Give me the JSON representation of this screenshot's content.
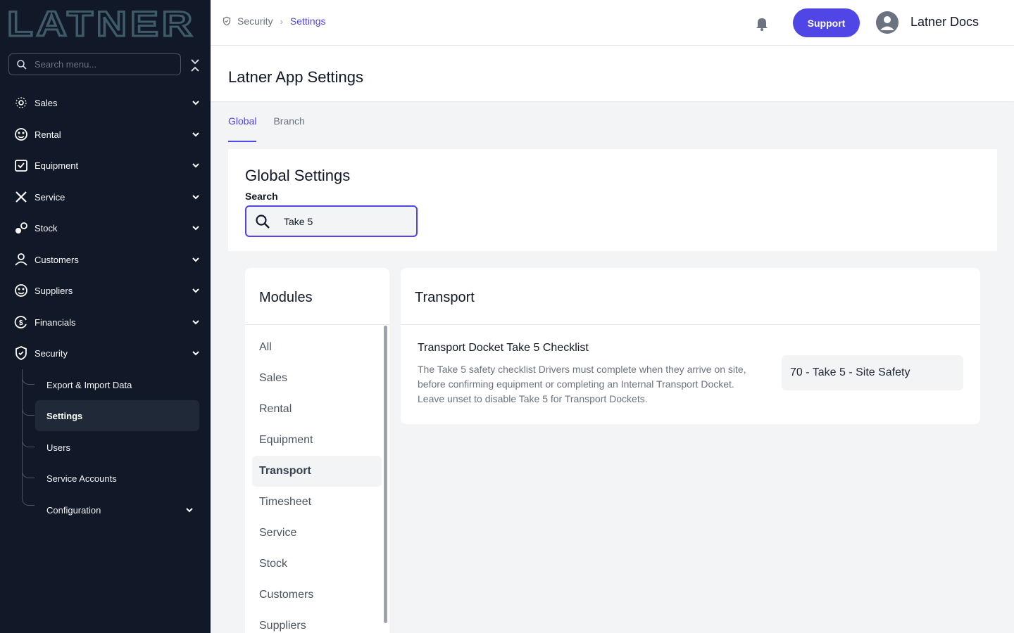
{
  "app": {
    "logo_text": "LATNER"
  },
  "sidebar": {
    "search_placeholder": "Search menu...",
    "items": [
      {
        "label": "Sales",
        "icon": "sales-icon"
      },
      {
        "label": "Rental",
        "icon": "rental-icon"
      },
      {
        "label": "Equipment",
        "icon": "equipment-icon"
      },
      {
        "label": "Service",
        "icon": "service-icon"
      },
      {
        "label": "Stock",
        "icon": "stock-icon"
      },
      {
        "label": "Customers",
        "icon": "customers-icon"
      },
      {
        "label": "Suppliers",
        "icon": "suppliers-icon"
      },
      {
        "label": "Financials",
        "icon": "financials-icon"
      },
      {
        "label": "Security",
        "icon": "shield-icon"
      }
    ],
    "security_sub": [
      {
        "label": "Export & Import Data"
      },
      {
        "label": "Settings"
      },
      {
        "label": "Users"
      },
      {
        "label": "Service Accounts"
      },
      {
        "label": "Configuration"
      }
    ]
  },
  "header": {
    "breadcrumb": [
      "Security",
      "Settings"
    ],
    "support_label": "Support",
    "user_name": "Latner Docs"
  },
  "page": {
    "title": "Latner App Settings"
  },
  "tabs": [
    {
      "label": "Global"
    },
    {
      "label": "Branch"
    }
  ],
  "global": {
    "title": "Global Settings",
    "search_label": "Search",
    "search_value": "Take 5"
  },
  "modules": {
    "title": "Modules",
    "items": [
      "All",
      "Sales",
      "Rental",
      "Equipment",
      "Transport",
      "Timesheet",
      "Service",
      "Stock",
      "Customers",
      "Suppliers"
    ],
    "selected": "Transport"
  },
  "transport": {
    "title": "Transport",
    "setting_name": "Transport Docket Take 5 Checklist",
    "setting_desc_1": "The Take 5 safety checklist Drivers must complete when they arrive on site,",
    "setting_desc_2": "before confirming equipment or completing an Internal Transport Docket.",
    "setting_desc_3": "Leave unset to disable Take 5 for Transport Dockets.",
    "setting_value": "70 - Take 5 - Site Safety"
  },
  "colors": {
    "sidebar_bg": "#111827",
    "accent": "#4f46e5",
    "logo": "#3f5a68"
  }
}
